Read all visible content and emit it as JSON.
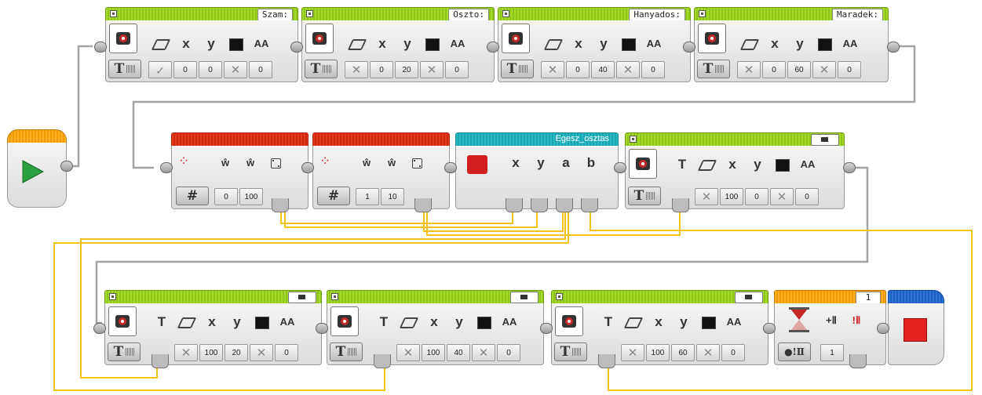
{
  "display_blocks_row1": [
    {
      "label": "Szam:",
      "values": [
        "✓",
        "0",
        "0",
        "✕",
        "0"
      ]
    },
    {
      "label": "Oszto:",
      "values": [
        "✕",
        "0",
        "20",
        "✕",
        "0"
      ]
    },
    {
      "label": "Hanyados:",
      "values": [
        "✕",
        "0",
        "40",
        "✕",
        "0"
      ]
    },
    {
      "label": "Maradek:",
      "values": [
        "✕",
        "0",
        "60",
        "✕",
        "0"
      ]
    }
  ],
  "display_icons": {
    "x": "x",
    "y": "y",
    "aa": "AA",
    "t": "T"
  },
  "random_blocks": [
    {
      "mode": "#",
      "values": [
        "0",
        "100"
      ]
    },
    {
      "mode": "#",
      "values": [
        "1",
        "10"
      ]
    }
  ],
  "myblock": {
    "label": "Egesz_osztas",
    "params": [
      "x",
      "y",
      "a",
      "b"
    ]
  },
  "display_text_row2": {
    "values": [
      "✕",
      "100",
      "0",
      "✕",
      "0"
    ]
  },
  "display_blocks_row3": [
    {
      "values": [
        "✕",
        "100",
        "20",
        "✕",
        "0"
      ]
    },
    {
      "values": [
        "✕",
        "100",
        "40",
        "✕",
        "0"
      ]
    },
    {
      "values": [
        "✕",
        "100",
        "60",
        "✕",
        "0"
      ]
    }
  ],
  "wait_block": {
    "label": "1",
    "value": "1"
  },
  "colors": {
    "wire": "#f2c21a",
    "green": "#8ec51a",
    "red": "#e03318",
    "teal": "#1aa5b0",
    "orange": "#f29a00",
    "blue": "#1d5ec0"
  }
}
